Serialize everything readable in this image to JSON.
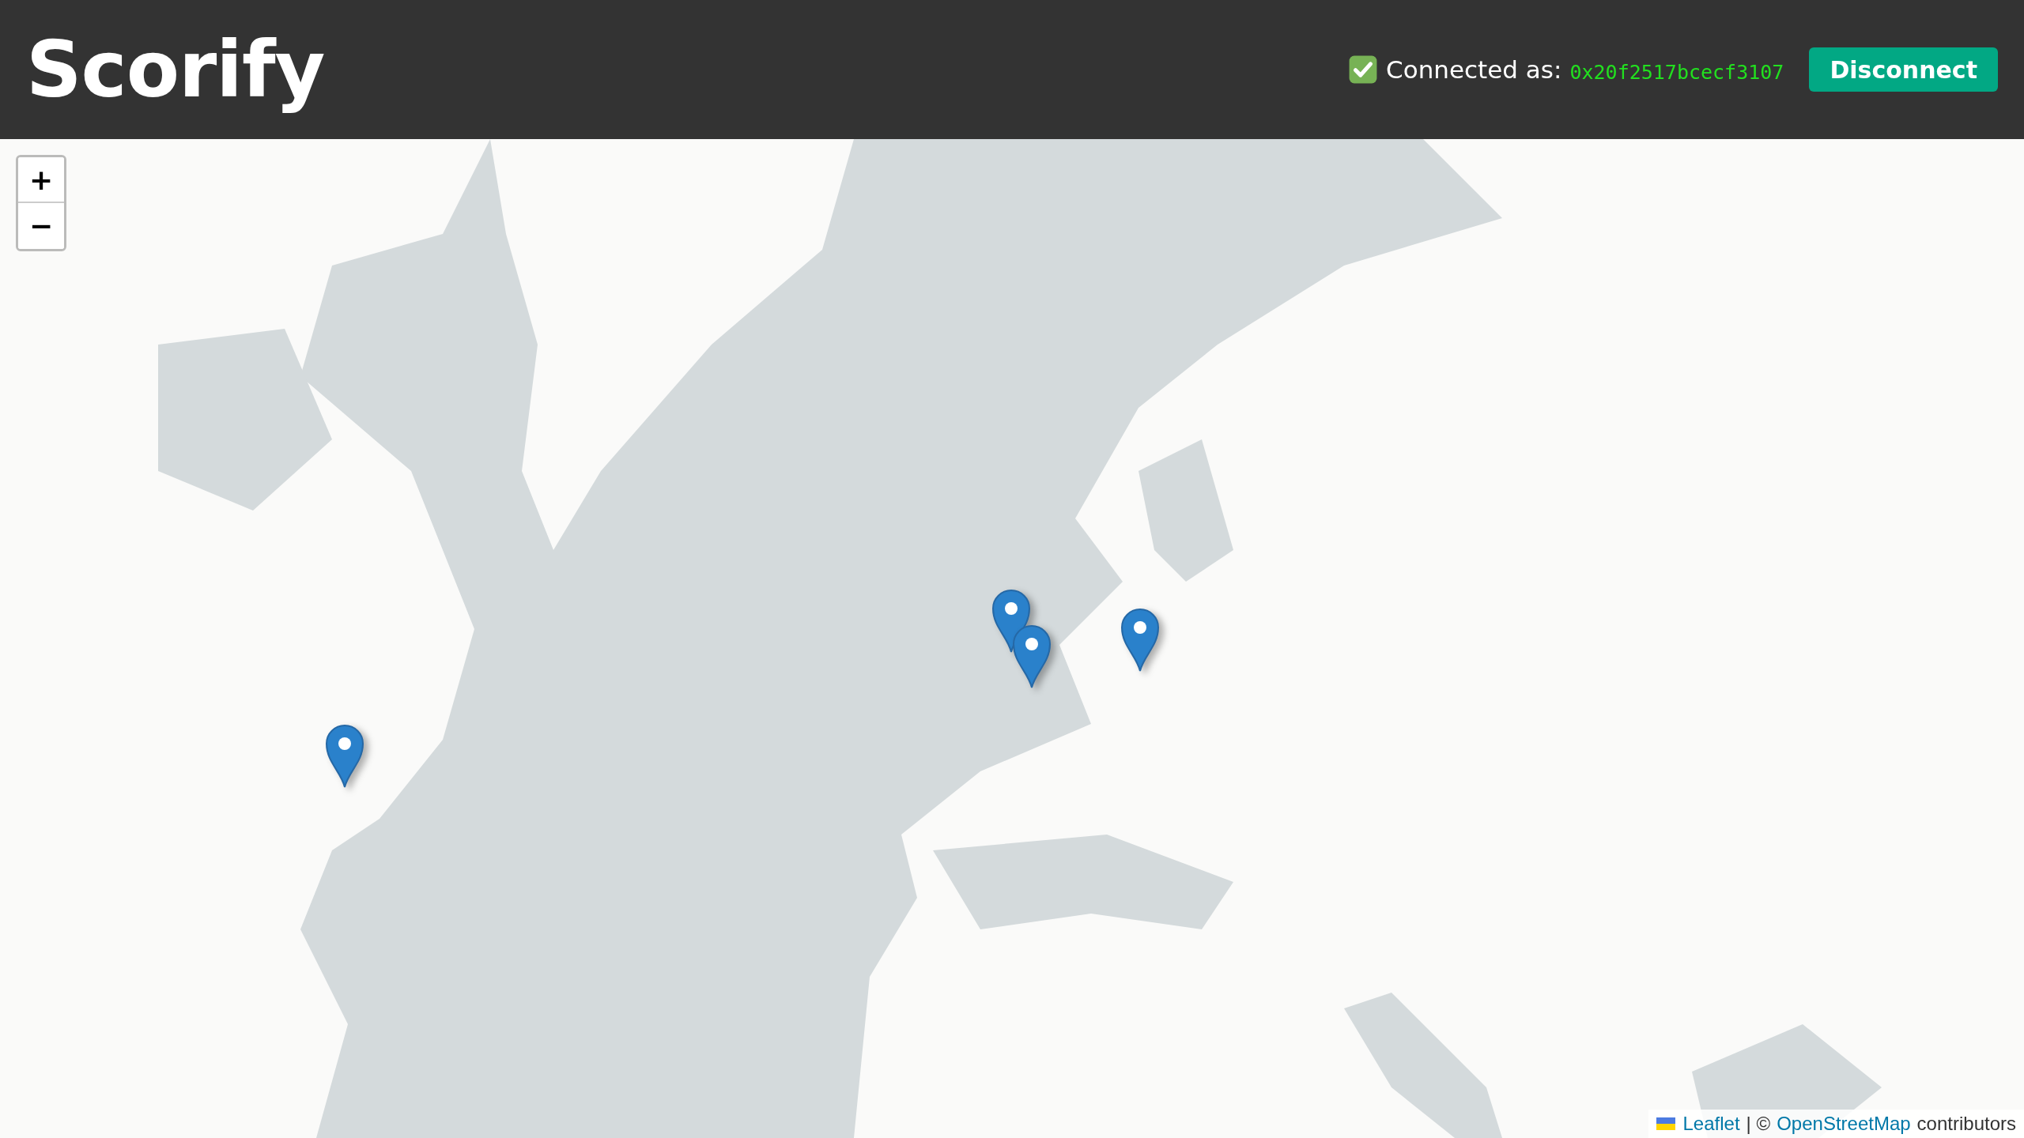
{
  "header": {
    "title": "Scorify",
    "status_label": "Connected as:",
    "address": "0x20f2517bcecf3107",
    "disconnect_button": "Disconnect"
  },
  "map": {
    "kind": "picture",
    "zoom_in": "+",
    "zoom_out": "−",
    "markers": [
      {
        "kind": "pin"
      },
      {
        "kind": "pin"
      },
      {
        "kind": "pin"
      },
      {
        "kind": "pin"
      }
    ],
    "attribution": {
      "leaflet_link": "Leaflet",
      "separator": "| ©",
      "osm_link": "OpenStreetMap",
      "suffix": "contributors"
    }
  }
}
